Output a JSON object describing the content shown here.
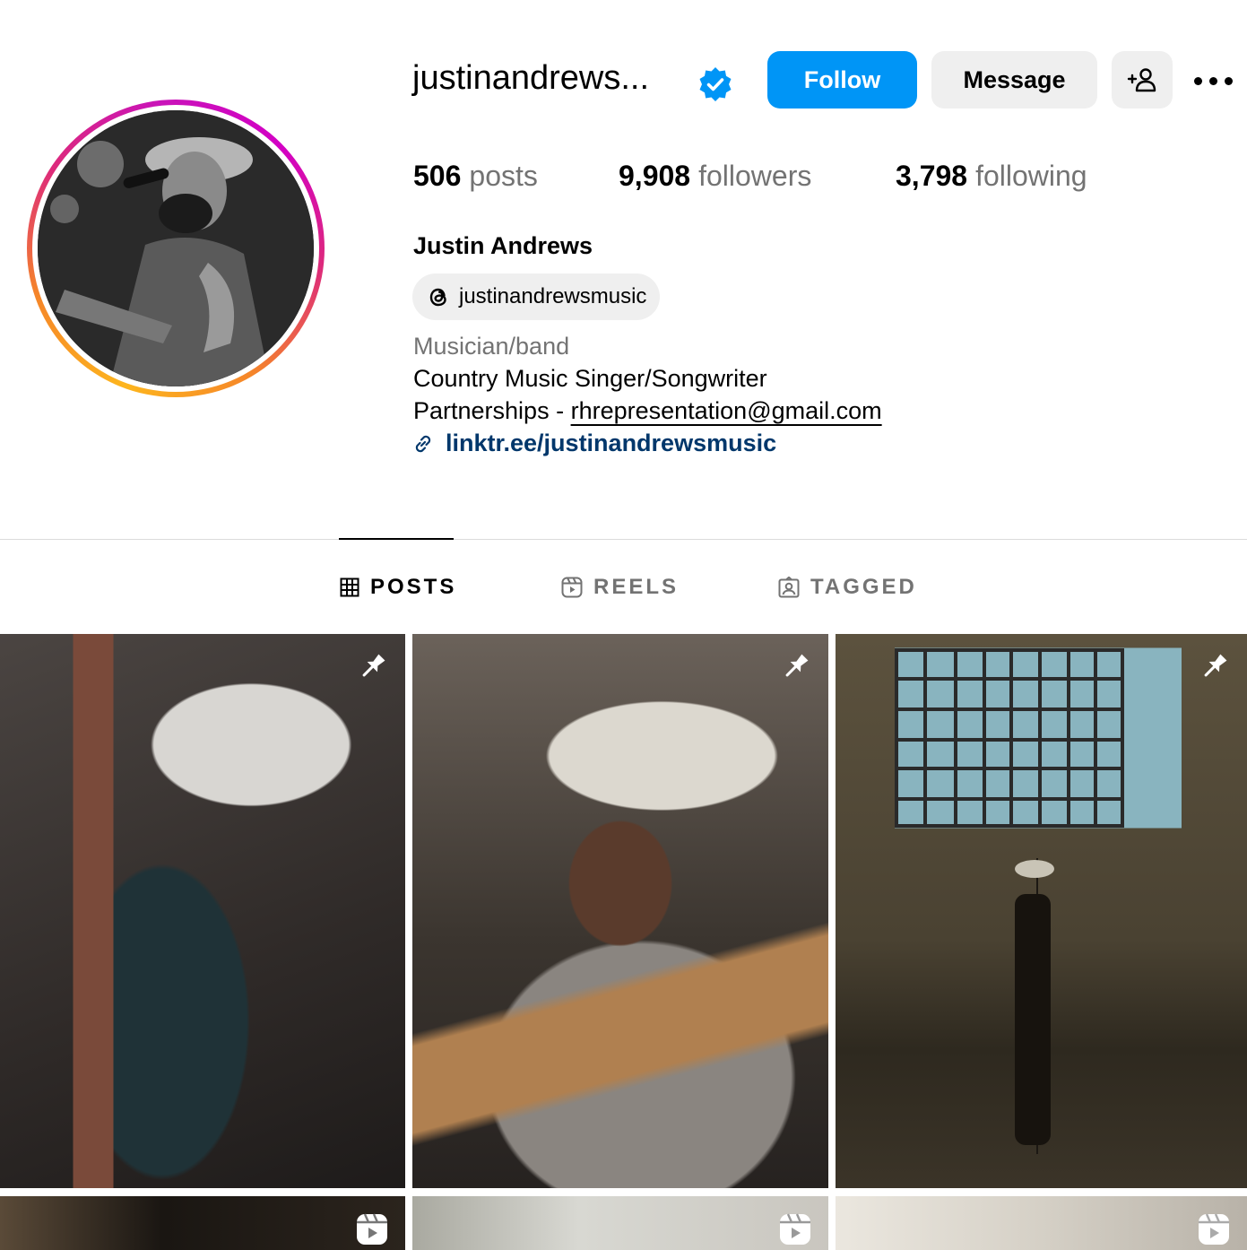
{
  "profile": {
    "username": "justinandrews...",
    "full_name": "Justin Andrews",
    "verified": true,
    "threads_handle": "justinandrewsmusic",
    "category": "Musician/band",
    "bio_line_1": "Country Music Singer/Songwriter",
    "bio_line_2_prefix": "Partnerships - ",
    "bio_email": "rhrepresentation@gmail.com",
    "link": "linktr.ee/justinandrewsmusic"
  },
  "actions": {
    "follow_label": "Follow",
    "message_label": "Message"
  },
  "stats": {
    "posts_count": "506",
    "posts_label": "posts",
    "followers_count": "9,908",
    "followers_label": "followers",
    "following_count": "3,798",
    "following_label": "following"
  },
  "tabs": [
    {
      "label": "POSTS",
      "icon": "grid-icon",
      "active": true
    },
    {
      "label": "REELS",
      "icon": "reels-icon",
      "active": false
    },
    {
      "label": "TAGGED",
      "icon": "tagged-icon",
      "active": false
    }
  ],
  "posts": [
    {
      "badge": "pin-icon"
    },
    {
      "badge": "pin-icon"
    },
    {
      "badge": "pin-icon"
    },
    {
      "badge": "reels-icon"
    },
    {
      "badge": "reels-icon"
    },
    {
      "badge": "reels-icon"
    }
  ],
  "colors": {
    "accent": "#0095f6",
    "link": "#00376b",
    "secondary_text": "#737373",
    "button_bg": "#efefef"
  }
}
